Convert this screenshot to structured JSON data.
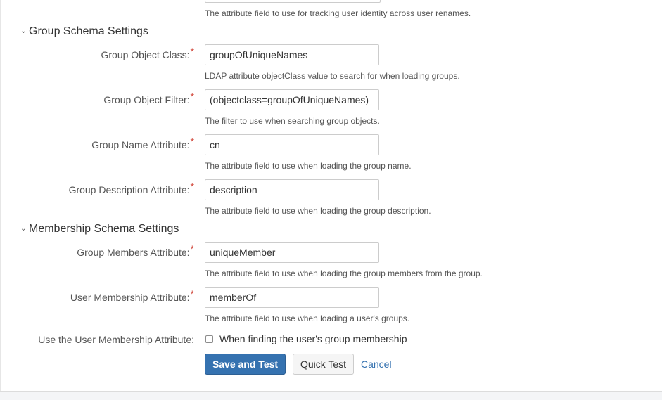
{
  "top": {
    "description": "The attribute field to use for tracking user identity across user renames."
  },
  "group_schema": {
    "title": "Group Schema Settings",
    "fields": [
      {
        "label": "Group Object Class:",
        "required": "*",
        "value": "groupOfUniqueNames",
        "description": "LDAP attribute objectClass value to search for when loading groups."
      },
      {
        "label": "Group Object Filter:",
        "required": "*",
        "value": "(objectclass=groupOfUniqueNames)",
        "description": "The filter to use when searching group objects."
      },
      {
        "label": "Group Name Attribute:",
        "required": "*",
        "value": "cn",
        "description": "The attribute field to use when loading the group name."
      },
      {
        "label": "Group Description Attribute:",
        "required": "*",
        "value": "description",
        "description": "The attribute field to use when loading the group description."
      }
    ]
  },
  "membership_schema": {
    "title": "Membership Schema Settings",
    "fields": [
      {
        "label": "Group Members Attribute:",
        "required": "*",
        "value": "uniqueMember",
        "description": "The attribute field to use when loading the group members from the group."
      },
      {
        "label": "User Membership Attribute:",
        "required": "*",
        "value": "memberOf",
        "description": "The attribute field to use when loading a user's groups."
      }
    ],
    "use_membership": {
      "label": "Use the User Membership Attribute:",
      "checkbox_label": "When finding the user's group membership",
      "checked": false
    }
  },
  "actions": {
    "save_and_test": "Save and Test",
    "quick_test": "Quick Test",
    "cancel": "Cancel"
  },
  "icons": {
    "section_toggle": "chevron-down-icon",
    "checkbox": "checkbox-icon"
  },
  "colors": {
    "primary_button": "#3572b0",
    "link": "#3572b0",
    "required": "#d04437"
  }
}
